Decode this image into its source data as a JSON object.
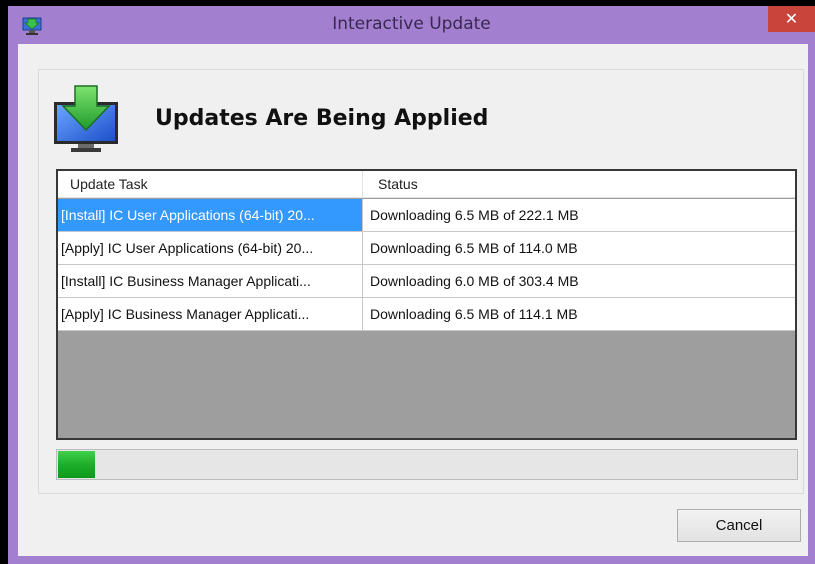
{
  "window": {
    "title": "Interactive Update",
    "close_label": "✕",
    "accent_color": "#a37fcf"
  },
  "header": {
    "heading": "Updates Are Being Applied",
    "icon": "download-monitor-icon"
  },
  "table": {
    "columns": [
      "Update Task",
      "Status"
    ],
    "rows": [
      {
        "task": "[Install] IC User Applications (64-bit) 20...",
        "status": "Downloading 6.5 MB of 222.1 MB",
        "selected": true
      },
      {
        "task": "[Apply] IC User Applications (64-bit) 20...",
        "status": "Downloading 6.5 MB of 114.0 MB",
        "selected": false
      },
      {
        "task": "[Install] IC Business Manager Applicati...",
        "status": "Downloading 6.0 MB of 303.4 MB",
        "selected": false
      },
      {
        "task": "[Apply] IC Business Manager Applicati...",
        "status": "Downloading 6.5 MB of 114.1 MB",
        "selected": false
      }
    ]
  },
  "progress": {
    "fraction": 0.05,
    "color": "#1fae2b"
  },
  "buttons": {
    "cancel_label": "Cancel"
  }
}
